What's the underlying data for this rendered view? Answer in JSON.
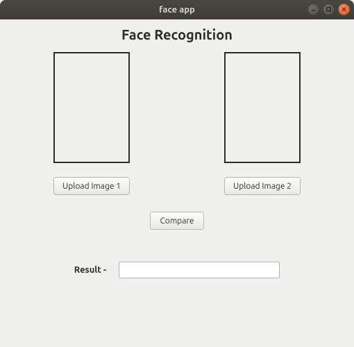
{
  "window": {
    "title": "face app"
  },
  "heading": "Face Recognition",
  "buttons": {
    "upload1": "Upload Image 1",
    "upload2": "Upload Image 2",
    "compare": "Compare"
  },
  "result": {
    "label": "Result -",
    "value": ""
  }
}
